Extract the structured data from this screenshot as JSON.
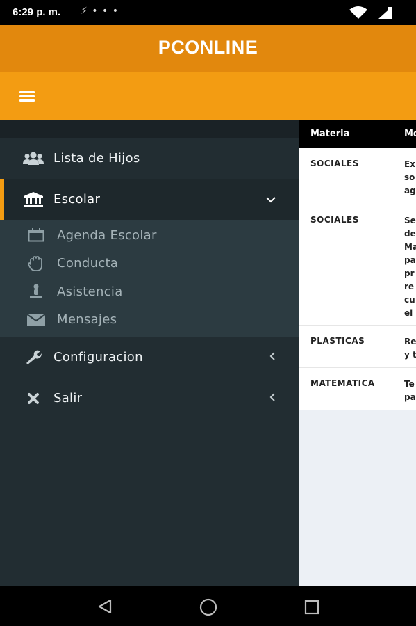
{
  "status_bar": {
    "time": "6:29 p. m.",
    "left_icons": "⚡ • • •"
  },
  "header": {
    "title": "PCONLINE"
  },
  "sidebar": {
    "items": [
      {
        "label": "Lista de Hijos",
        "icon": "users-icon"
      },
      {
        "label": "Escolar",
        "icon": "institution-icon",
        "chevron": "chevron-down-icon"
      },
      {
        "label": "Configuracion",
        "icon": "wrench-icon",
        "chevron": "chevron-left-icon"
      },
      {
        "label": "Salir",
        "icon": "close-icon",
        "chevron": "chevron-left-icon"
      }
    ],
    "submenu": [
      {
        "label": "Agenda Escolar",
        "icon": "calendar-icon"
      },
      {
        "label": "Conducta",
        "icon": "hand-icon"
      },
      {
        "label": "Asistencia",
        "icon": "person-icon"
      },
      {
        "label": "Mensajes",
        "icon": "envelope-icon"
      }
    ]
  },
  "table": {
    "headers": [
      "Materia",
      "Mo"
    ],
    "rows": [
      {
        "materia": "SOCIALES",
        "desc": "Ex\nso\nag"
      },
      {
        "materia": "SOCIALES",
        "desc": "Se\nde\nMa\npa\npr\nre\ncu\nel"
      },
      {
        "materia": "PLASTICAS",
        "desc": "Re\ny t"
      },
      {
        "materia": "MATEMATICA",
        "desc": "Te\npa"
      }
    ]
  },
  "colors": {
    "header": "#E2880D",
    "toolbar": "#F39C12",
    "sidebar": "#222D32",
    "submenu": "#2C3B41"
  }
}
